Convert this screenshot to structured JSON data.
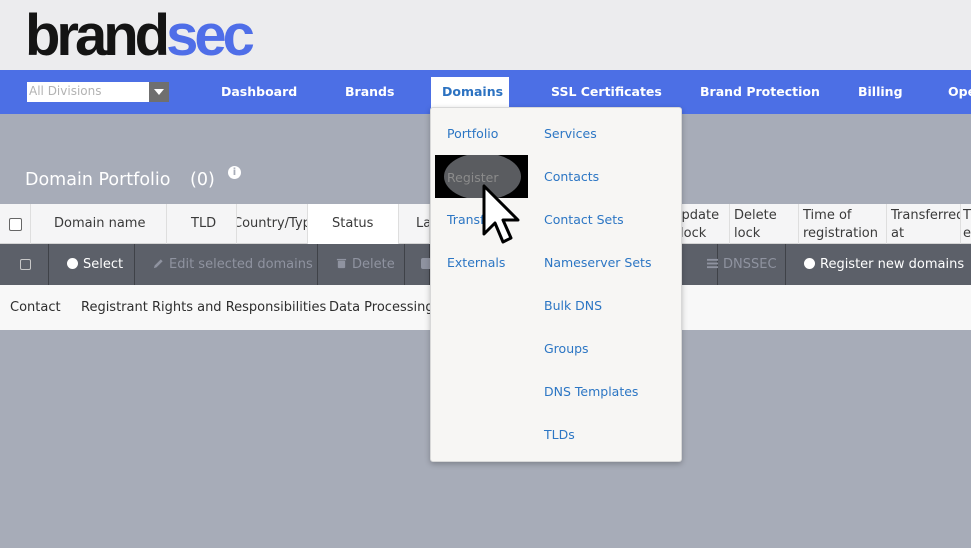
{
  "brand": {
    "part1": "brand",
    "part2": "sec"
  },
  "division_select": {
    "value": "All Divisions"
  },
  "nav": {
    "items": [
      "Dashboard",
      "Brands",
      "Domains",
      "SSL Certificates",
      "Brand Protection",
      "Billing",
      "Ope"
    ],
    "active": "Domains"
  },
  "page": {
    "title": "Domain Portfolio",
    "count": "(0)"
  },
  "table": {
    "headers": [
      "Domain name",
      "TLD",
      "Country/Type",
      "Status",
      "La",
      "Update lock",
      "Delete lock",
      "Time of registration",
      "Transferred at",
      "T e"
    ]
  },
  "toolbar": {
    "select": "Select",
    "edit": "Edit selected domains",
    "delete": "Delete",
    "dnssec": "DNSSEC",
    "register_new": "Register new domains"
  },
  "footer": {
    "links": [
      "Contact",
      "Registrant Rights and Responsibilities",
      "Data Processing"
    ]
  },
  "dropdown": {
    "col1": [
      "Portfolio",
      "Register",
      "Transfer",
      "Externals"
    ],
    "col2": [
      "Services",
      "Contacts",
      "Contact Sets",
      "Nameserver Sets",
      "Bulk DNS",
      "Groups",
      "DNS Templates",
      "TLDs"
    ]
  },
  "icons": {
    "info": "info-icon",
    "select": "plus-circle-icon",
    "edit": "pencil-icon",
    "delete": "trash-icon",
    "dnssec": "list-icon",
    "register_new": "plus-circle-icon",
    "cursor": "pointer-hand-icon"
  },
  "colors": {
    "navbar": "#4c6fe5",
    "link": "#2c76c4",
    "brand_accent": "#4f6ee8",
    "toolbar": "#5c6069",
    "backdrop": "#a7acb8"
  }
}
